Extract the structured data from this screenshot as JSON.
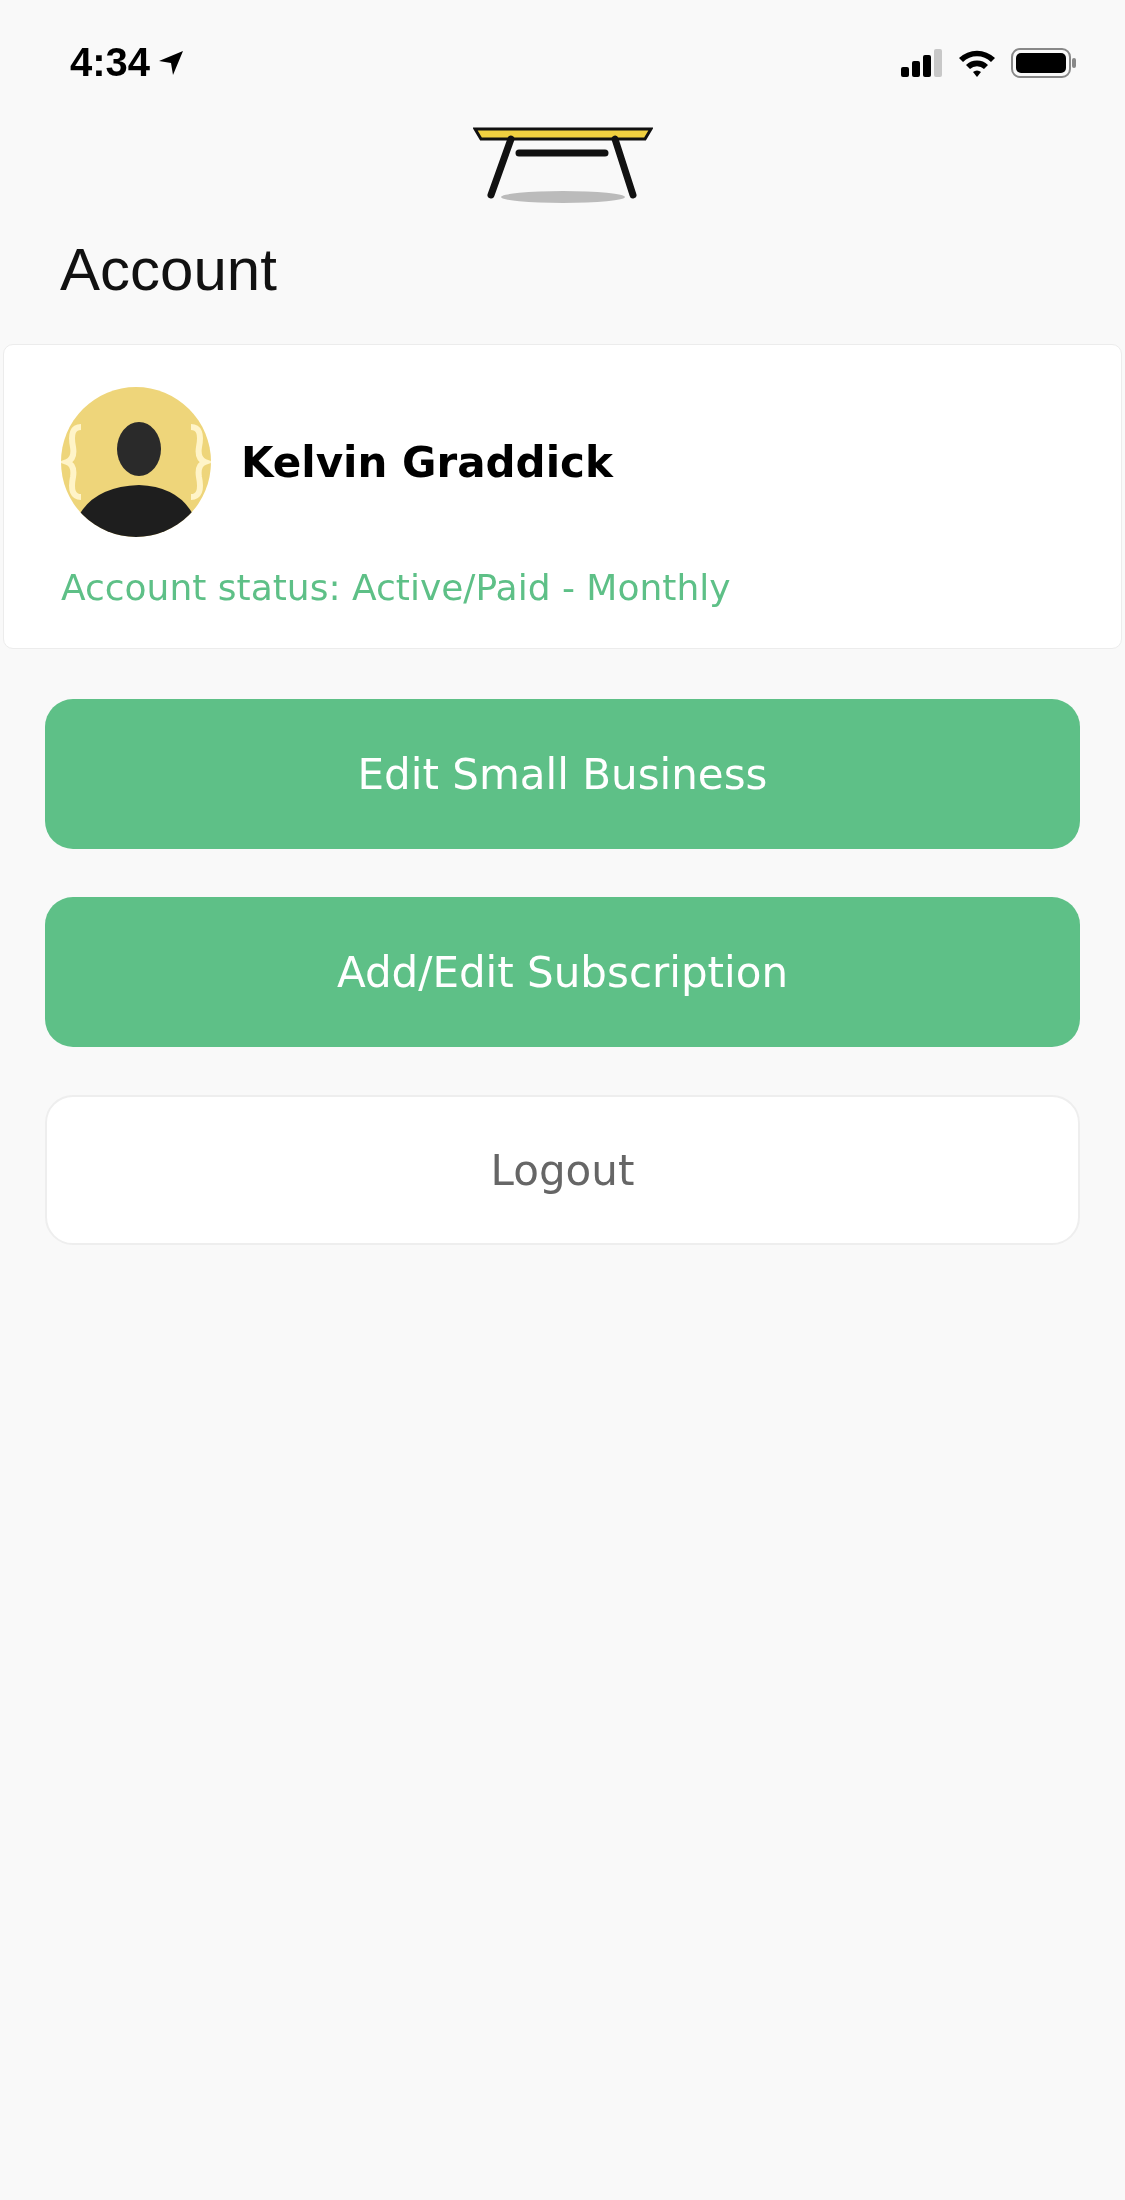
{
  "status_bar": {
    "time": "4:34"
  },
  "header": {
    "title": "Account"
  },
  "profile": {
    "name": "Kelvin Graddick",
    "status": "Account status: Active/Paid - Monthly"
  },
  "buttons": [
    {
      "label": "Edit Small Business",
      "kind": "primary"
    },
    {
      "label": "Add/Edit Subscription",
      "kind": "primary"
    },
    {
      "label": "Logout",
      "kind": "secondary"
    }
  ]
}
